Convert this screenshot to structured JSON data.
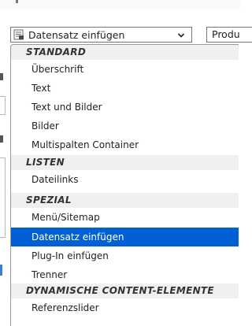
{
  "toolbar": {
    "type_select_value": "Datensatz einfügen",
    "second_select_value": "Produ"
  },
  "dropdown": {
    "groups": [
      {
        "label": "STANDARD",
        "options": [
          "Überschrift",
          "Text",
          "Text und Bilder",
          "Bilder",
          "Multispalten Container"
        ]
      },
      {
        "label": "LISTEN",
        "options": [
          "Dateilinks"
        ]
      },
      {
        "label": "SPEZIAL",
        "options": [
          "Menü/Sitemap",
          "Datensatz einfügen",
          "Plug-In einfügen",
          "Trenner"
        ]
      },
      {
        "label": "DYNAMISCHE CONTENT-ELEMENTE",
        "options": [
          "Referenzslider"
        ]
      }
    ],
    "selected": "Datensatz einfügen",
    "selected_color": "#0060d4"
  },
  "icons": {
    "select_icon": "record-list-icon",
    "dropdown_arrow": "chevron-down-icon"
  }
}
